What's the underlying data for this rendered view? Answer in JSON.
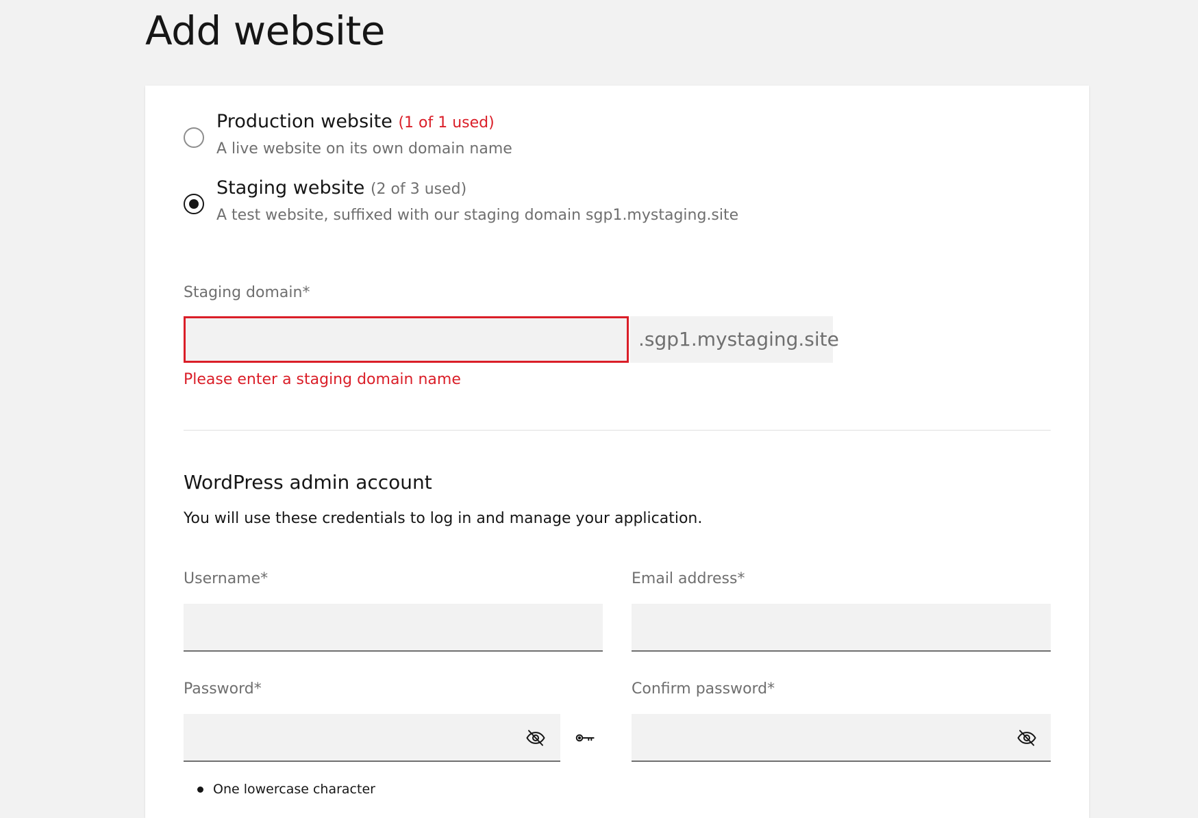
{
  "page": {
    "title": "Add website"
  },
  "website_type": {
    "options": [
      {
        "title": "Production website",
        "usage": "(1 of 1 used)",
        "description": "A live website on its own domain name",
        "selected": false
      },
      {
        "title": "Staging website",
        "usage": "(2 of 3 used)",
        "description": "A test website, suffixed with our staging domain sgp1.mystaging.site",
        "selected": true
      }
    ]
  },
  "staging_domain": {
    "label": "Staging domain*",
    "value": "",
    "suffix": ".sgp1.mystaging.site",
    "error": "Please enter a staging domain name"
  },
  "admin_account": {
    "title": "WordPress admin account",
    "description": "You will use these credentials to log in and manage your application.",
    "username": {
      "label": "Username*",
      "value": ""
    },
    "email": {
      "label": "Email address*",
      "value": ""
    },
    "password": {
      "label": "Password*",
      "value": ""
    },
    "confirm_password": {
      "label": "Confirm password*",
      "value": ""
    },
    "requirements": [
      "One lowercase character"
    ]
  },
  "colors": {
    "error": "#da1e28",
    "muted": "#6f6f6f",
    "text": "#161616",
    "field_bg": "#f2f2f2"
  },
  "icons": {
    "show_password": "eye-off-icon",
    "generate_password": "key-icon"
  }
}
